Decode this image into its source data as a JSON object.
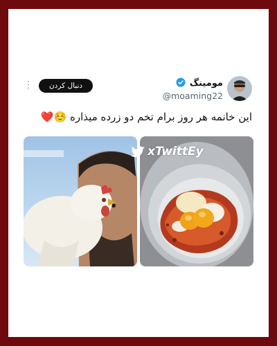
{
  "tweet": {
    "display_name": "مومینگ",
    "username": "@moaming22",
    "follow_label": "دنبال کردن",
    "more_label": "⋮",
    "text": "این خانمه هر روز برام تخم دو زرده میذاره",
    "text_emojis": "☺️❤️"
  },
  "media": {
    "watermark": "xTwittEy"
  },
  "colors": {
    "frame_border": "#6e0a0e",
    "verified_badge": "#1d9bf0",
    "follow_button": "#111111"
  }
}
